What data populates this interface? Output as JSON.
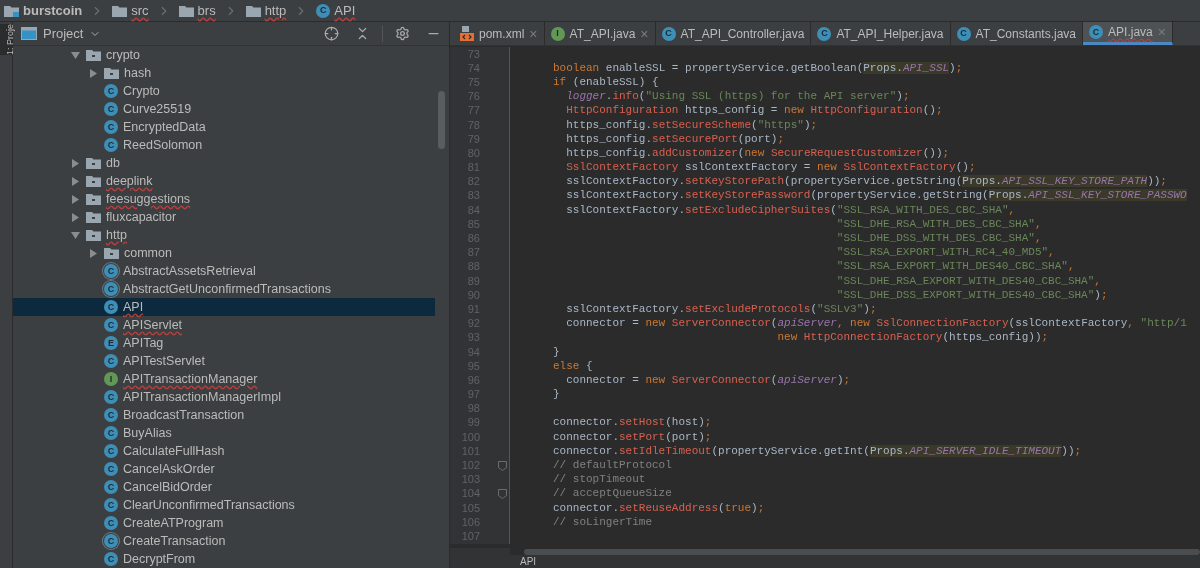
{
  "breadcrumbs": [
    {
      "label": "burstcoin",
      "kind": "project",
      "error": false
    },
    {
      "label": "src",
      "kind": "folder",
      "error": true
    },
    {
      "label": "brs",
      "kind": "folder",
      "error": true
    },
    {
      "label": "http",
      "kind": "folder",
      "error": true
    },
    {
      "label": "API",
      "kind": "class",
      "badge": "C",
      "error": true
    }
  ],
  "side_tab": {
    "label": "1: Proje",
    "selected": true
  },
  "project_panel": {
    "title": "Project",
    "tree": [
      {
        "label": "crypto",
        "kind": "folder",
        "expanded": true,
        "selected": false,
        "error": false,
        "children": [
          {
            "label": "hash",
            "kind": "folder",
            "expanded": false,
            "selected": false,
            "error": false
          },
          {
            "label": "Crypto",
            "kind": "class",
            "badge": "C",
            "selected": false,
            "error": false
          },
          {
            "label": "Curve25519",
            "kind": "class",
            "badge": "C",
            "selected": false,
            "error": false
          },
          {
            "label": "EncryptedData",
            "kind": "class",
            "badge": "C",
            "selected": false,
            "error": false
          },
          {
            "label": "ReedSolomon",
            "kind": "class",
            "badge": "C",
            "selected": false,
            "error": false
          }
        ]
      },
      {
        "label": "db",
        "kind": "folder",
        "expanded": false,
        "selected": false,
        "error": false
      },
      {
        "label": "deeplink",
        "kind": "folder",
        "expanded": false,
        "selected": false,
        "error": true
      },
      {
        "label": "feesuggestions",
        "kind": "folder",
        "expanded": false,
        "selected": false,
        "error": true
      },
      {
        "label": "fluxcapacitor",
        "kind": "folder",
        "expanded": false,
        "selected": false,
        "error": false
      },
      {
        "label": "http",
        "kind": "folder",
        "expanded": true,
        "selected": false,
        "error": true,
        "children": [
          {
            "label": "common",
            "kind": "folder",
            "expanded": false,
            "selected": false,
            "error": false
          },
          {
            "label": "AbstractAssetsRetrieval",
            "kind": "abstract",
            "badge": "C",
            "selected": false,
            "error": false
          },
          {
            "label": "AbstractGetUnconfirmedTransactions",
            "kind": "abstract",
            "badge": "C",
            "selected": false,
            "error": false
          },
          {
            "label": "API",
            "kind": "class",
            "badge": "C",
            "selected": true,
            "error": true
          },
          {
            "label": "APIServlet",
            "kind": "class",
            "badge": "C",
            "selected": false,
            "error": true
          },
          {
            "label": "APITag",
            "kind": "enum",
            "badge": "E",
            "selected": false,
            "error": false
          },
          {
            "label": "APITestServlet",
            "kind": "class",
            "badge": "C",
            "selected": false,
            "error": false
          },
          {
            "label": "APITransactionManager",
            "kind": "interface",
            "badge": "I",
            "selected": false,
            "error": true
          },
          {
            "label": "APITransactionManagerImpl",
            "kind": "class",
            "badge": "C",
            "selected": false,
            "error": false
          },
          {
            "label": "BroadcastTransaction",
            "kind": "class",
            "badge": "C",
            "selected": false,
            "error": false
          },
          {
            "label": "BuyAlias",
            "kind": "class",
            "badge": "C",
            "selected": false,
            "error": false
          },
          {
            "label": "CalculateFullHash",
            "kind": "class",
            "badge": "C",
            "selected": false,
            "error": false
          },
          {
            "label": "CancelAskOrder",
            "kind": "class",
            "badge": "C",
            "selected": false,
            "error": false
          },
          {
            "label": "CancelBidOrder",
            "kind": "class",
            "badge": "C",
            "selected": false,
            "error": false
          },
          {
            "label": "ClearUnconfirmedTransactions",
            "kind": "class",
            "badge": "C",
            "selected": false,
            "error": false
          },
          {
            "label": "CreateATProgram",
            "kind": "class",
            "badge": "C",
            "selected": false,
            "error": false
          },
          {
            "label": "CreateTransaction",
            "kind": "abstract",
            "badge": "C",
            "selected": false,
            "error": false
          },
          {
            "label": "DecryptFrom",
            "kind": "class",
            "badge": "C",
            "selected": false,
            "error": false
          }
        ]
      }
    ]
  },
  "tabs": [
    {
      "label": "pom.xml",
      "kind": "xml",
      "selected": false,
      "error": false,
      "close": "×"
    },
    {
      "label": "AT_API.java",
      "kind": "interface",
      "badge": "I",
      "selected": false,
      "error": false,
      "close": "×"
    },
    {
      "label": "AT_API_Controller.java",
      "kind": "class",
      "badge": "C",
      "selected": false,
      "error": false
    },
    {
      "label": "AT_API_Helper.java",
      "kind": "class",
      "badge": "C",
      "selected": false,
      "error": false
    },
    {
      "label": "AT_Constants.java",
      "kind": "class",
      "badge": "C",
      "selected": false,
      "error": false
    },
    {
      "label": "API.java",
      "kind": "class",
      "badge": "C",
      "selected": true,
      "error": true,
      "close": "×"
    }
  ],
  "code_lines": [
    {
      "number": "73"
    },
    {
      "number": "74",
      "tokens": [
        {
          "kind": "kw",
          "text": "boolean"
        },
        {
          "kind": "plain",
          "text": " enableSSL = propertyService.getBoolean("
        },
        {
          "kind": "hl",
          "text": "Props."
        },
        {
          "kind": "hlfield",
          "text": "API_SSL"
        },
        {
          "kind": "plain",
          "text": ")"
        },
        {
          "kind": "kw",
          "text": ";"
        }
      ]
    },
    {
      "number": "75",
      "tokens": [
        {
          "kind": "kw",
          "text": "if"
        },
        {
          "kind": "plain",
          "text": " (enableSSL) {"
        }
      ]
    },
    {
      "number": "76",
      "tokens": [
        {
          "kind": "field",
          "text": "  logger"
        },
        {
          "kind": "plain",
          "text": "."
        },
        {
          "kind": "err",
          "text": "info"
        },
        {
          "kind": "plain",
          "text": "("
        },
        {
          "kind": "str",
          "text": "\"Using SSL (https) for the API server\""
        },
        {
          "kind": "plain",
          "text": ")"
        },
        {
          "kind": "kw",
          "text": ";"
        }
      ]
    },
    {
      "number": "77",
      "tokens": [
        {
          "kind": "err",
          "text": "  HttpConfiguration"
        },
        {
          "kind": "plain",
          "text": " https_config = "
        },
        {
          "kind": "kw",
          "text": "new"
        },
        {
          "kind": "err",
          "text": " HttpConfiguration"
        },
        {
          "kind": "plain",
          "text": "()"
        },
        {
          "kind": "kw",
          "text": ";"
        }
      ]
    },
    {
      "number": "78",
      "tokens": [
        {
          "kind": "plain",
          "text": "  https_config."
        },
        {
          "kind": "err",
          "text": "setSecureScheme"
        },
        {
          "kind": "plain",
          "text": "("
        },
        {
          "kind": "str",
          "text": "\"https\""
        },
        {
          "kind": "plain",
          "text": ")"
        },
        {
          "kind": "kw",
          "text": ";"
        }
      ]
    },
    {
      "number": "79",
      "tokens": [
        {
          "kind": "plain",
          "text": "  https_config."
        },
        {
          "kind": "err",
          "text": "setSecurePort"
        },
        {
          "kind": "plain",
          "text": "(port)"
        },
        {
          "kind": "kw",
          "text": ";"
        }
      ]
    },
    {
      "number": "80",
      "tokens": [
        {
          "kind": "plain",
          "text": "  https_config."
        },
        {
          "kind": "err",
          "text": "addCustomizer"
        },
        {
          "kind": "plain",
          "text": "("
        },
        {
          "kind": "kw",
          "text": "new"
        },
        {
          "kind": "err",
          "text": " SecureRequestCustomizer"
        },
        {
          "kind": "plain",
          "text": "())"
        },
        {
          "kind": "kw",
          "text": ";"
        }
      ]
    },
    {
      "number": "81",
      "tokens": [
        {
          "kind": "err",
          "text": "  SslContextFactory"
        },
        {
          "kind": "plain",
          "text": " sslContextFactory = "
        },
        {
          "kind": "kw",
          "text": "new"
        },
        {
          "kind": "err",
          "text": " SslContextFactory"
        },
        {
          "kind": "plain",
          "text": "()"
        },
        {
          "kind": "kw",
          "text": ";"
        }
      ]
    },
    {
      "number": "82",
      "tokens": [
        {
          "kind": "plain",
          "text": "  sslContextFactory."
        },
        {
          "kind": "err",
          "text": "setKeyStorePath"
        },
        {
          "kind": "plain",
          "text": "(propertyService.getString("
        },
        {
          "kind": "hl",
          "text": "Props."
        },
        {
          "kind": "hlfield",
          "text": "API_SSL_KEY_STORE_PATH"
        },
        {
          "kind": "plain",
          "text": "))"
        },
        {
          "kind": "kw",
          "text": ";"
        }
      ]
    },
    {
      "number": "83",
      "tokens": [
        {
          "kind": "plain",
          "text": "  sslContextFactory."
        },
        {
          "kind": "err",
          "text": "setKeyStorePassword"
        },
        {
          "kind": "plain",
          "text": "(propertyService.getString("
        },
        {
          "kind": "hl",
          "text": "Props."
        },
        {
          "kind": "hlfield",
          "text": "API_SSL_KEY_STORE_PASSWO"
        }
      ]
    },
    {
      "number": "84",
      "tokens": [
        {
          "kind": "plain",
          "text": "  sslContextFactory."
        },
        {
          "kind": "err",
          "text": "setExcludeCipherSuites"
        },
        {
          "kind": "plain",
          "text": "("
        },
        {
          "kind": "str",
          "text": "\"SSL_RSA_WITH_DES_CBC_SHA\""
        },
        {
          "kind": "kw",
          "text": ","
        }
      ]
    },
    {
      "number": "85",
      "tokens": [
        {
          "kind": "str",
          "text": "                                           \"SSL_DHE_RSA_WITH_DES_CBC_SHA\""
        },
        {
          "kind": "kw",
          "text": ","
        }
      ]
    },
    {
      "number": "86",
      "tokens": [
        {
          "kind": "str",
          "text": "                                           \"SSL_DHE_DSS_WITH_DES_CBC_SHA\""
        },
        {
          "kind": "kw",
          "text": ","
        }
      ]
    },
    {
      "number": "87",
      "tokens": [
        {
          "kind": "str",
          "text": "                                           \"SSL_RSA_EXPORT_WITH_RC4_40_MD5\""
        },
        {
          "kind": "kw",
          "text": ","
        }
      ]
    },
    {
      "number": "88",
      "tokens": [
        {
          "kind": "str",
          "text": "                                           \"SSL_RSA_EXPORT_WITH_DES40_CBC_SHA\""
        },
        {
          "kind": "kw",
          "text": ","
        }
      ]
    },
    {
      "number": "89",
      "tokens": [
        {
          "kind": "str",
          "text": "                                           \"SSL_DHE_RSA_EXPORT_WITH_DES40_CBC_SHA\""
        },
        {
          "kind": "kw",
          "text": ","
        }
      ]
    },
    {
      "number": "90",
      "tokens": [
        {
          "kind": "str",
          "text": "                                           \"SSL_DHE_DSS_EXPORT_WITH_DES40_CBC_SHA\""
        },
        {
          "kind": "plain",
          "text": ")"
        },
        {
          "kind": "kw",
          "text": ";"
        }
      ]
    },
    {
      "number": "91",
      "tokens": [
        {
          "kind": "plain",
          "text": "  sslContextFactory."
        },
        {
          "kind": "err",
          "text": "setExcludeProtocols"
        },
        {
          "kind": "plain",
          "text": "("
        },
        {
          "kind": "str",
          "text": "\"SSLv3\""
        },
        {
          "kind": "plain",
          "text": ")"
        },
        {
          "kind": "kw",
          "text": ";"
        }
      ]
    },
    {
      "number": "92",
      "tokens": [
        {
          "kind": "plain",
          "text": "  connector = "
        },
        {
          "kind": "kw",
          "text": "new"
        },
        {
          "kind": "err",
          "text": " ServerConnector"
        },
        {
          "kind": "plain",
          "text": "("
        },
        {
          "kind": "field",
          "text": "apiServer"
        },
        {
          "kind": "kw",
          "text": ", new"
        },
        {
          "kind": "err",
          "text": " SslConnectionFactory"
        },
        {
          "kind": "plain",
          "text": "(sslContextFactory"
        },
        {
          "kind": "kw",
          "text": ","
        },
        {
          "kind": "str",
          "text": " \"http/1"
        }
      ]
    },
    {
      "number": "93",
      "tokens": [
        {
          "kind": "kw",
          "text": "                                  new"
        },
        {
          "kind": "err",
          "text": " HttpConnectionFactory"
        },
        {
          "kind": "plain",
          "text": "(https_config))"
        },
        {
          "kind": "kw",
          "text": ";"
        }
      ]
    },
    {
      "number": "94",
      "tokens": [
        {
          "kind": "plain",
          "text": "}"
        }
      ]
    },
    {
      "number": "95",
      "tokens": [
        {
          "kind": "kw",
          "text": "else"
        },
        {
          "kind": "plain",
          "text": " {"
        }
      ]
    },
    {
      "number": "96",
      "tokens": [
        {
          "kind": "plain",
          "text": "  connector = "
        },
        {
          "kind": "kw",
          "text": "new"
        },
        {
          "kind": "err",
          "text": " ServerConnector"
        },
        {
          "kind": "plain",
          "text": "("
        },
        {
          "kind": "field",
          "text": "apiServer"
        },
        {
          "kind": "plain",
          "text": ")"
        },
        {
          "kind": "kw",
          "text": ";"
        }
      ]
    },
    {
      "number": "97",
      "tokens": [
        {
          "kind": "plain",
          "text": "}"
        }
      ]
    },
    {
      "number": "98"
    },
    {
      "number": "99",
      "tokens": [
        {
          "kind": "plain",
          "text": "connector."
        },
        {
          "kind": "err",
          "text": "setHost"
        },
        {
          "kind": "plain",
          "text": "(host)"
        },
        {
          "kind": "kw",
          "text": ";"
        }
      ]
    },
    {
      "number": "100",
      "tokens": [
        {
          "kind": "plain",
          "text": "connector."
        },
        {
          "kind": "err",
          "text": "setPort"
        },
        {
          "kind": "plain",
          "text": "(port)"
        },
        {
          "kind": "kw",
          "text": ";"
        }
      ]
    },
    {
      "number": "101",
      "tokens": [
        {
          "kind": "plain",
          "text": "connector."
        },
        {
          "kind": "err",
          "text": "setIdleTimeout"
        },
        {
          "kind": "plain",
          "text": "(propertyService.getInt("
        },
        {
          "kind": "hl",
          "text": "Props."
        },
        {
          "kind": "hlfield",
          "text": "API_SERVER_IDLE_TIMEOUT"
        },
        {
          "kind": "plain",
          "text": "))"
        },
        {
          "kind": "kw",
          "text": ";"
        }
      ]
    },
    {
      "number": "102",
      "fold": true,
      "tokens": [
        {
          "kind": "comment",
          "text": "// defaultProtocol"
        }
      ]
    },
    {
      "number": "103",
      "tokens": [
        {
          "kind": "comment",
          "text": "// stopTimeout"
        }
      ]
    },
    {
      "number": "104",
      "fold": true,
      "tokens": [
        {
          "kind": "comment",
          "text": "// acceptQueueSize"
        }
      ]
    },
    {
      "number": "105",
      "tokens": [
        {
          "kind": "plain",
          "text": "connector."
        },
        {
          "kind": "err",
          "text": "setReuseAddress"
        },
        {
          "kind": "plain",
          "text": "("
        },
        {
          "kind": "kw",
          "text": "true"
        },
        {
          "kind": "plain",
          "text": ")"
        },
        {
          "kind": "kw",
          "text": ";"
        }
      ]
    },
    {
      "number": "106",
      "tokens": [
        {
          "kind": "comment",
          "text": "// soLingerTime"
        }
      ]
    },
    {
      "number": "107"
    }
  ],
  "editor_breadcrumb": "API"
}
